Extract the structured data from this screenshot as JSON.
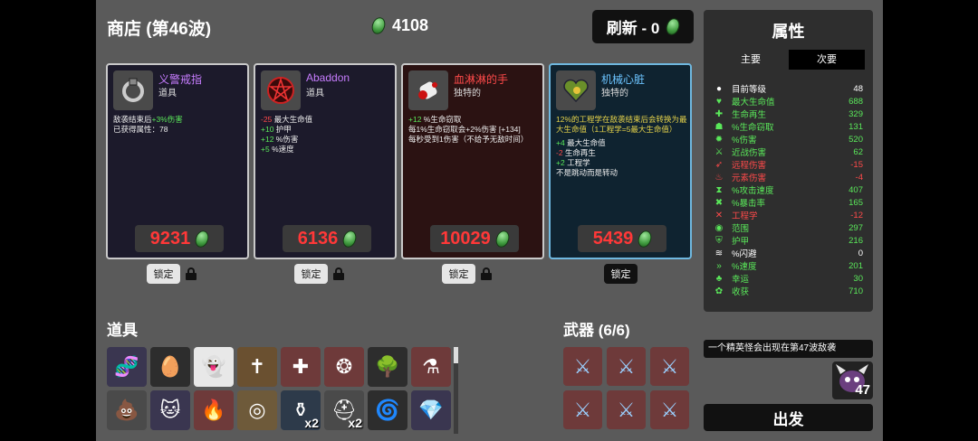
{
  "shop": {
    "title": "商店 (第46波)",
    "money": "4108",
    "reroll": "刷新 - 0"
  },
  "cards": [
    {
      "name": "义警戒指",
      "type": "道具",
      "lines": [
        [
          "敌袭结束后",
          "+3%伤害"
        ],
        [
          "已获得属性：78"
        ]
      ],
      "price": "9231",
      "icon": "ring-icon",
      "lock": "锁定"
    },
    {
      "name": "Abaddon",
      "type": "道具",
      "lines": [
        [
          "-25",
          " 最大生命值"
        ],
        [
          "+10",
          " 护甲"
        ],
        [
          "+12",
          " %伤害"
        ],
        [
          "+5",
          " %速度"
        ]
      ],
      "price": "6136",
      "icon": "pentagram-icon",
      "lock": "锁定"
    },
    {
      "name": "血淋淋的手",
      "type": "独特的",
      "lines": [
        [
          "+12",
          " %生命窃取"
        ],
        [
          "每1%生命窃取会+2%伤害 [+134]"
        ],
        [
          "每秒受到1伤害（不给予无敌时间）"
        ]
      ],
      "price": "10029",
      "icon": "bloody-hand-icon",
      "lock": "锁定"
    },
    {
      "name": "机械心脏",
      "type": "独特的",
      "lines": [
        [
          "12%的工程学在敌袭结束后会转换为最大生命值（1工程学=5最大生命值）"
        ],
        [
          "+4",
          " 最大生命值"
        ],
        [
          "-2",
          " 生命再生"
        ],
        [
          "+2",
          " 工程学"
        ],
        [
          "不是跳动而是转动"
        ]
      ],
      "price": "5439",
      "icon": "mech-heart-icon",
      "lock": "锁定"
    }
  ],
  "stats": {
    "title": "属性",
    "tab_main": "主要",
    "tab_secondary": "次要",
    "rows": [
      {
        "label": "目前等级",
        "value": "48",
        "color": "#ffffff",
        "icon": "level-icon"
      },
      {
        "label": "最大生命值",
        "value": "688",
        "color": "#5ae85a",
        "icon": "heart-icon"
      },
      {
        "label": "生命再生",
        "value": "329",
        "color": "#5ae85a",
        "icon": "regen-icon"
      },
      {
        "label": "%生命窃取",
        "value": "131",
        "color": "#5ae85a",
        "icon": "lifesteal-icon"
      },
      {
        "label": "%伤害",
        "value": "520",
        "color": "#5ae85a",
        "icon": "damage-icon"
      },
      {
        "label": "近战伤害",
        "value": "62",
        "color": "#5ae85a",
        "icon": "melee-icon"
      },
      {
        "label": "远程伤害",
        "value": "-15",
        "color": "#ff4a4a",
        "icon": "ranged-icon"
      },
      {
        "label": "元素伤害",
        "value": "-4",
        "color": "#ff4a4a",
        "icon": "elemental-icon"
      },
      {
        "label": "%攻击速度",
        "value": "407",
        "color": "#5ae85a",
        "icon": "attack-speed-icon"
      },
      {
        "label": "%暴击率",
        "value": "165",
        "color": "#5ae85a",
        "icon": "crit-icon"
      },
      {
        "label": "工程学",
        "value": "-12",
        "color": "#ff4a4a",
        "icon": "engineering-icon"
      },
      {
        "label": "范围",
        "value": "297",
        "color": "#5ae85a",
        "icon": "range-icon"
      },
      {
        "label": "护甲",
        "value": "216",
        "color": "#5ae85a",
        "icon": "armor-icon"
      },
      {
        "label": "%闪避",
        "value": "0",
        "color": "#ffffff",
        "icon": "dodge-icon"
      },
      {
        "label": "%速度",
        "value": "201",
        "color": "#5ae85a",
        "icon": "speed-icon"
      },
      {
        "label": "幸运",
        "value": "30",
        "color": "#5ae85a",
        "icon": "luck-icon"
      },
      {
        "label": "收获",
        "value": "710",
        "color": "#5ae85a",
        "icon": "harvest-icon"
      }
    ]
  },
  "items": {
    "title": "道具",
    "slots": [
      {
        "icon": "dna-icon",
        "count": ""
      },
      {
        "icon": "egg-icon",
        "count": ""
      },
      {
        "icon": "ghost-face-icon",
        "count": ""
      },
      {
        "icon": "holy-book-icon",
        "count": ""
      },
      {
        "icon": "medkit-icon",
        "count": ""
      },
      {
        "icon": "wreath-icon",
        "count": ""
      },
      {
        "icon": "tree-icon",
        "count": ""
      },
      {
        "icon": "potion-icon",
        "count": ""
      },
      {
        "icon": "poop-icon",
        "count": ""
      },
      {
        "icon": "cat-icon",
        "count": ""
      },
      {
        "icon": "fire-icon",
        "count": ""
      },
      {
        "icon": "collar-icon",
        "count": ""
      },
      {
        "icon": "flask-icon",
        "count": "x2"
      },
      {
        "icon": "helmet-icon",
        "count": "x2"
      },
      {
        "icon": "red-spiral-icon",
        "count": ""
      },
      {
        "icon": "crystal-icon",
        "count": ""
      }
    ]
  },
  "weapons": {
    "title": "武器 (6/6)"
  },
  "wave_notice": "一个精英怪会出现在第47波敌袭",
  "boss_wave": "47",
  "go_label": "出发"
}
